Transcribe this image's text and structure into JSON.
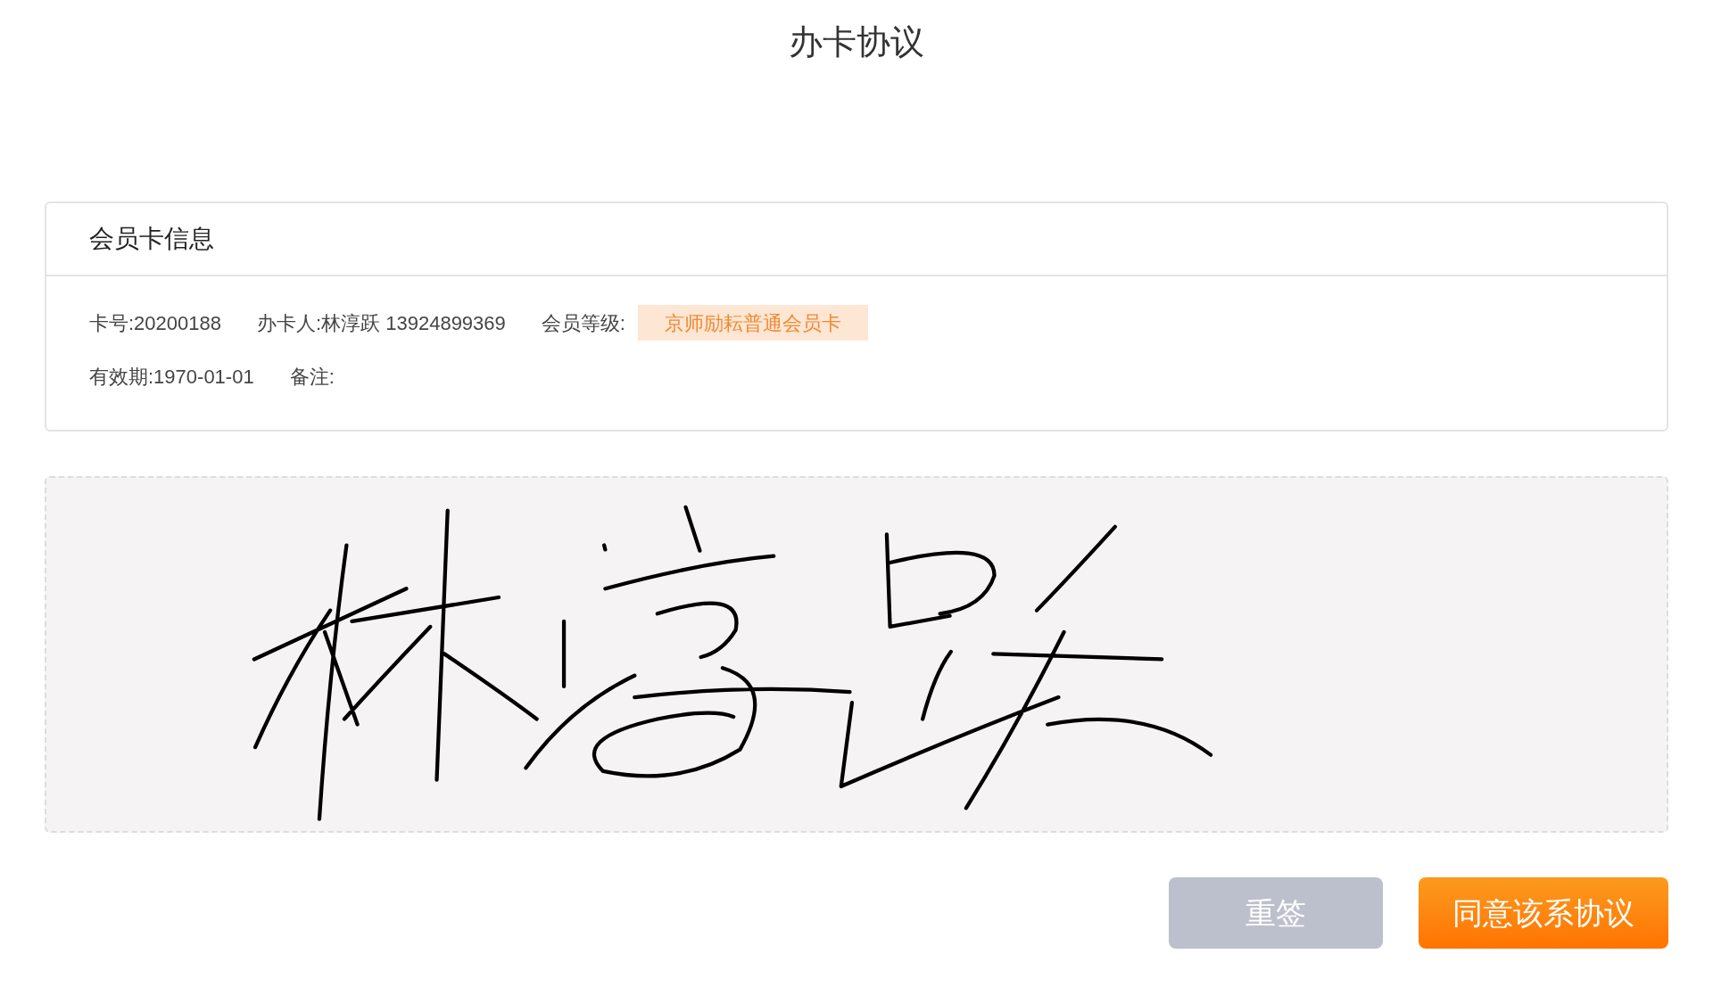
{
  "title": "办卡协议",
  "card": {
    "heading": "会员卡信息",
    "rows": [
      [
        {
          "kind": "text",
          "text": "卡号:20200188"
        },
        {
          "kind": "text",
          "text": "办卡人:林淳跃 13924899369"
        },
        {
          "kind": "text",
          "text": "会员等级:"
        },
        {
          "kind": "badge",
          "text": "京师励耘普通会员卡"
        }
      ],
      [
        {
          "kind": "text",
          "text": "有效期:1970-01-01"
        },
        {
          "kind": "text",
          "text": "备注:"
        }
      ]
    ]
  },
  "signature_pad": {
    "signed": true
  },
  "buttons": [
    {
      "label": "重签",
      "kind": "secondary"
    },
    {
      "label": "同意该系协议",
      "kind": "primary"
    }
  ]
}
